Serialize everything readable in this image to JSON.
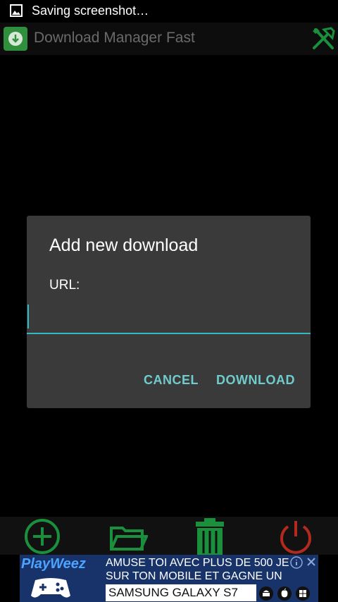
{
  "status_bar": {
    "notification_text": "Saving screenshot…",
    "icon": "image-icon"
  },
  "action_bar": {
    "title": "Download Manager Fast",
    "app_icon": "download-icon",
    "tools_icon": "tools-icon"
  },
  "dialog": {
    "title": "Add new download",
    "url_label": "URL:",
    "url_value": "",
    "cancel_label": "CANCEL",
    "download_label": "DOWNLOAD"
  },
  "toolbar": {
    "buttons": [
      {
        "icon": "add-icon",
        "color": "#1a8f3c"
      },
      {
        "icon": "open-folder-icon",
        "color": "#1a8f3c"
      },
      {
        "icon": "trash-icon",
        "color": "#1a8f3c"
      },
      {
        "icon": "power-icon",
        "color": "#b22a1e"
      }
    ]
  },
  "ad": {
    "brand": "PlayWeez",
    "line1": "AMUSE TOI AVEC PLUS DE 500 JE",
    "line2": "SUR TON MOBILE ET GAGNE UN",
    "device": "SAMSUNG GALAXY S7",
    "platform_icons": [
      "android-icon",
      "apple-icon",
      "windows-icon"
    ]
  },
  "colors": {
    "accent": "#34b9c3",
    "button_text": "#70cccc",
    "dialog_bg": "#3a3a3a",
    "toolbar_green": "#1a8f3c",
    "power_red": "#b22a1e"
  }
}
